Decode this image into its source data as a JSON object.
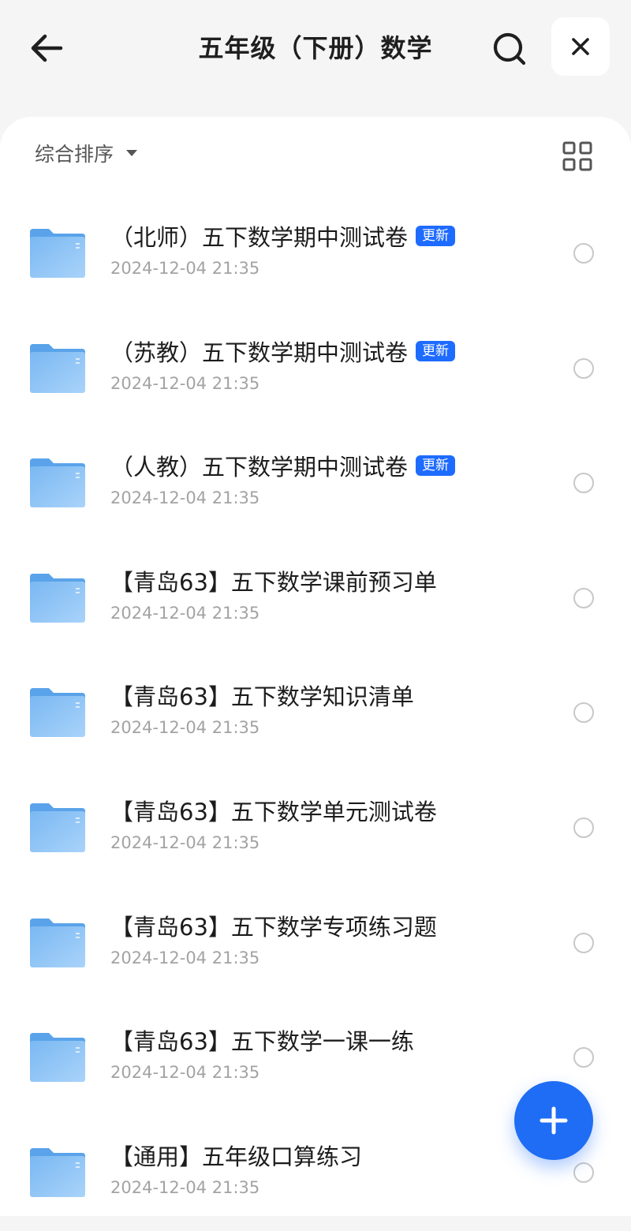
{
  "header": {
    "title": "五年级（下册）数学",
    "back_icon": "back-arrow-icon",
    "search_icon": "search-icon",
    "close_icon": "close-icon"
  },
  "toolbar": {
    "sort_label": "综合排序",
    "sort_icon": "caret-down-icon",
    "view_icon": "grid-view-icon"
  },
  "files": [
    {
      "name": "（北师）五下数学期中测试卷",
      "badge": "更新",
      "date": "2024-12-04 21:35"
    },
    {
      "name": "（苏教）五下数学期中测试卷",
      "badge": "更新",
      "date": "2024-12-04 21:35"
    },
    {
      "name": "（人教）五下数学期中测试卷",
      "badge": "更新",
      "date": "2024-12-04 21:35"
    },
    {
      "name": "【青岛63】五下数学课前预习单",
      "badge": "",
      "date": "2024-12-04 21:35"
    },
    {
      "name": "【青岛63】五下数学知识清单",
      "badge": "",
      "date": "2024-12-04 21:35"
    },
    {
      "name": "【青岛63】五下数学单元测试卷",
      "badge": "",
      "date": "2024-12-04 21:35"
    },
    {
      "name": "【青岛63】五下数学专项练习题",
      "badge": "",
      "date": "2024-12-04 21:35"
    },
    {
      "name": "【青岛63】五下数学一课一练",
      "badge": "",
      "date": "2024-12-04 21:35"
    },
    {
      "name": "【通用】五年级口算练习",
      "badge": "",
      "date": "2024-12-04 21:35"
    }
  ],
  "fab": {
    "icon": "plus-icon"
  },
  "colors": {
    "accent": "#1f6df5",
    "badge": "#1e6bff",
    "folder": "#7ab8f2",
    "background": "#f5f5f5"
  }
}
